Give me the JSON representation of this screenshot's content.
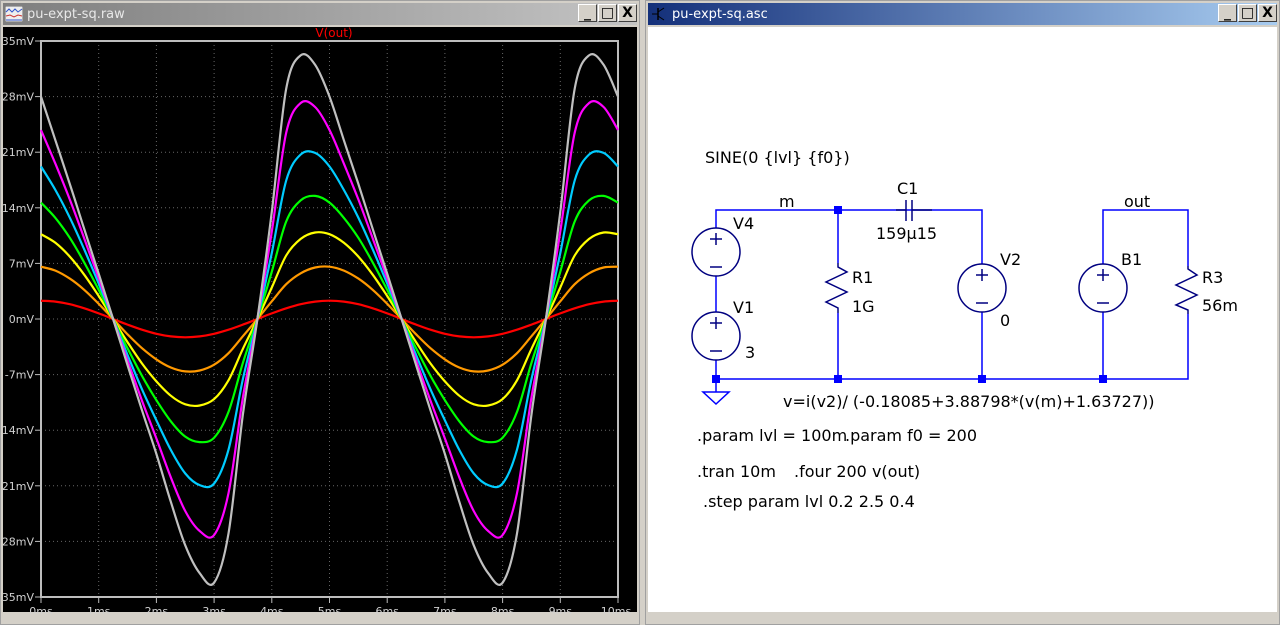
{
  "waveform_window": {
    "title": "pu-expt-sq.raw",
    "buttons": {
      "minimize": "_",
      "maximize": "□",
      "close": "X"
    }
  },
  "schematic_window": {
    "title": "pu-expt-sq.asc",
    "buttons": {
      "minimize": "_",
      "maximize": "□",
      "close": "X"
    }
  },
  "chart_data": {
    "type": "line",
    "title": "V(out)",
    "xlabel": "",
    "ylabel": "",
    "xlim": [
      0,
      10
    ],
    "ylim": [
      -35,
      35
    ],
    "x_unit": "ms",
    "y_unit": "mV",
    "grid": true,
    "x_ticks": [
      "0ms",
      "1ms",
      "2ms",
      "3ms",
      "4ms",
      "5ms",
      "6ms",
      "7ms",
      "8ms",
      "9ms",
      "10ms"
    ],
    "y_ticks": [
      "35mV",
      "28mV",
      "21mV",
      "14mV",
      "7mV",
      "0mV",
      "-7mV",
      "-14mV",
      "-21mV",
      "-28mV",
      "-35mV"
    ],
    "period_ms": 5,
    "sample_step_ms": 0.25,
    "series": [
      {
        "color": "#ff0000",
        "values": [
          2.3,
          2.19,
          1.86,
          1.35,
          0.71,
          0,
          -0.71,
          -1.35,
          -1.86,
          -2.19,
          -2.3,
          -2.19,
          -1.86,
          -1.35,
          -0.71,
          0,
          0.71,
          1.35,
          1.86,
          2.19
        ]
      },
      {
        "color": "#ff9900",
        "values": [
          6.58,
          6.09,
          5.09,
          3.66,
          1.91,
          0,
          -1.92,
          -3.67,
          -5.09,
          -6.11,
          -6.6,
          -6.48,
          -5.75,
          -4.3,
          -2.17,
          0,
          2.23,
          4.38,
          5.75,
          6.48
        ]
      },
      {
        "color": "#ffff00",
        "values": [
          10.67,
          9.59,
          7.85,
          5.57,
          2.89,
          0,
          -2.91,
          -5.6,
          -7.85,
          -9.66,
          -10.74,
          -10.89,
          -10.08,
          -7.72,
          -3.75,
          0,
          3.96,
          7.99,
          10.08,
          10.89
        ]
      },
      {
        "color": "#00ff00",
        "values": [
          14.66,
          12.73,
          10.22,
          7.1,
          3.68,
          0,
          -3.69,
          -7.16,
          -10.22,
          -12.88,
          -14.81,
          -15.5,
          -14.94,
          -11.7,
          -5.51,
          0,
          5.95,
          12.28,
          14.94,
          15.5
        ]
      },
      {
        "color": "#00ccff",
        "values": [
          19.2,
          16.24,
          12.75,
          8.74,
          4.47,
          0,
          -4.53,
          -8.85,
          -12.75,
          -16.48,
          -19.45,
          -20.91,
          -20.71,
          -16.46,
          -7.56,
          0,
          8.31,
          17.44,
          20.71,
          20.91
        ]
      },
      {
        "color": "#ff00ff",
        "values": [
          23.8,
          19.55,
          15.04,
          10.12,
          5.14,
          0,
          -5.23,
          -10.29,
          -15.04,
          -19.93,
          -24.19,
          -26.69,
          -27.19,
          -21.93,
          -9.87,
          0,
          11.01,
          23.44,
          27.19,
          26.69
        ]
      },
      {
        "color": "#c0c0c0",
        "values": [
          28.0,
          22.5,
          17.0,
          11.3,
          5.7,
          0,
          -5.8,
          -11.5,
          -17.0,
          -23.0,
          -28.5,
          -32.0,
          -33.2,
          -27.0,
          -12.0,
          0,
          13.5,
          29.0,
          33.2,
          32.0
        ]
      }
    ]
  },
  "schematic": {
    "source_spec": "SINE(0 {lvl} {f0})",
    "net_m": "m",
    "net_out": "out",
    "V4": {
      "name": "V4"
    },
    "V1": {
      "name": "V1",
      "value": "3"
    },
    "R1": {
      "name": "R1",
      "value": "1G"
    },
    "C1": {
      "name": "C1",
      "value": "159µ15"
    },
    "V2": {
      "name": "V2",
      "value": "0"
    },
    "B1": {
      "name": "B1",
      "value": "v=i(v2)/ (-0.18085+3.88798*(v(m)+1.63727))"
    },
    "R3": {
      "name": "R3",
      "value": "56m"
    },
    "directives": {
      "param_lvl": ".param lvl = 100m",
      "param_f0": ".param f0 = 200",
      "tran": ".tran 10m",
      "four": ".four 200 v(out)",
      "step": ".step param lvl 0.2 2.5  0.4"
    },
    "colors": {
      "wire": "#0000ff",
      "component": "#000080",
      "text": "#000000"
    }
  }
}
